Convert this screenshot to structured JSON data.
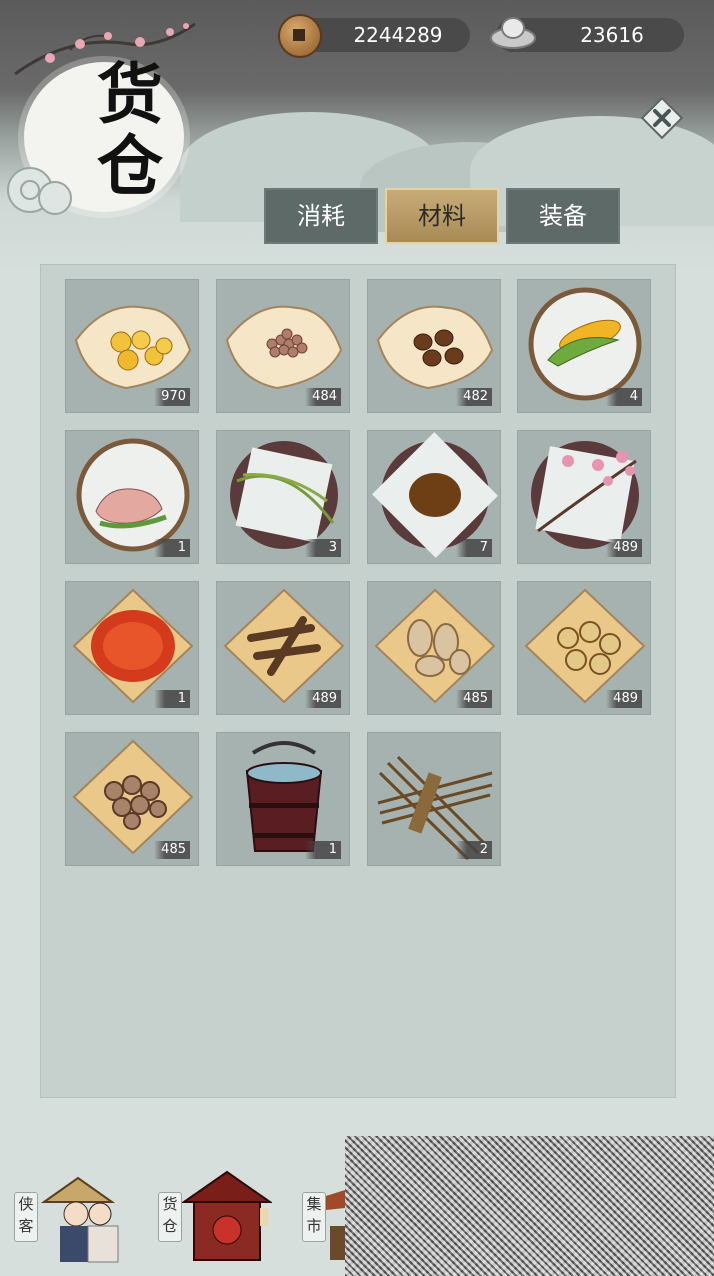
{
  "header": {
    "title": "货仓",
    "copper_coins": "2244289",
    "silver": "23616"
  },
  "tabs": [
    {
      "label": "消耗",
      "active": false
    },
    {
      "label": "材料",
      "active": true
    },
    {
      "label": "装备",
      "active": false
    }
  ],
  "items": [
    {
      "icon": "corn-kernels-icon",
      "count": "970"
    },
    {
      "icon": "beans-icon",
      "count": "484"
    },
    {
      "icon": "chestnuts-icon",
      "count": "482"
    },
    {
      "icon": "corn-cob-icon",
      "count": "4"
    },
    {
      "icon": "raw-meat-icon",
      "count": "1"
    },
    {
      "icon": "rice-stalks-icon",
      "count": "3"
    },
    {
      "icon": "dark-beans-icon",
      "count": "7"
    },
    {
      "icon": "plum-blossom-branch-icon",
      "count": "489"
    },
    {
      "icon": "red-chili-strips-icon",
      "count": "1"
    },
    {
      "icon": "dried-roots-icon",
      "count": "489"
    },
    {
      "icon": "dried-slices-icon",
      "count": "485"
    },
    {
      "icon": "mushroom-slices-icon",
      "count": "489"
    },
    {
      "icon": "mushrooms-icon",
      "count": "485"
    },
    {
      "icon": "water-bucket-icon",
      "count": "1"
    },
    {
      "icon": "straw-bundle-icon",
      "count": "2"
    }
  ],
  "bottom_nav": [
    {
      "label": "侠客",
      "icon": "heroes-icon"
    },
    {
      "label": "货仓",
      "icon": "warehouse-icon"
    },
    {
      "label": "集市",
      "icon": "market-icon"
    }
  ],
  "colors": {
    "active_tab": "#b89a63",
    "inactive_tab": "#5e6a68",
    "slot_bg": "#a6b2af"
  }
}
